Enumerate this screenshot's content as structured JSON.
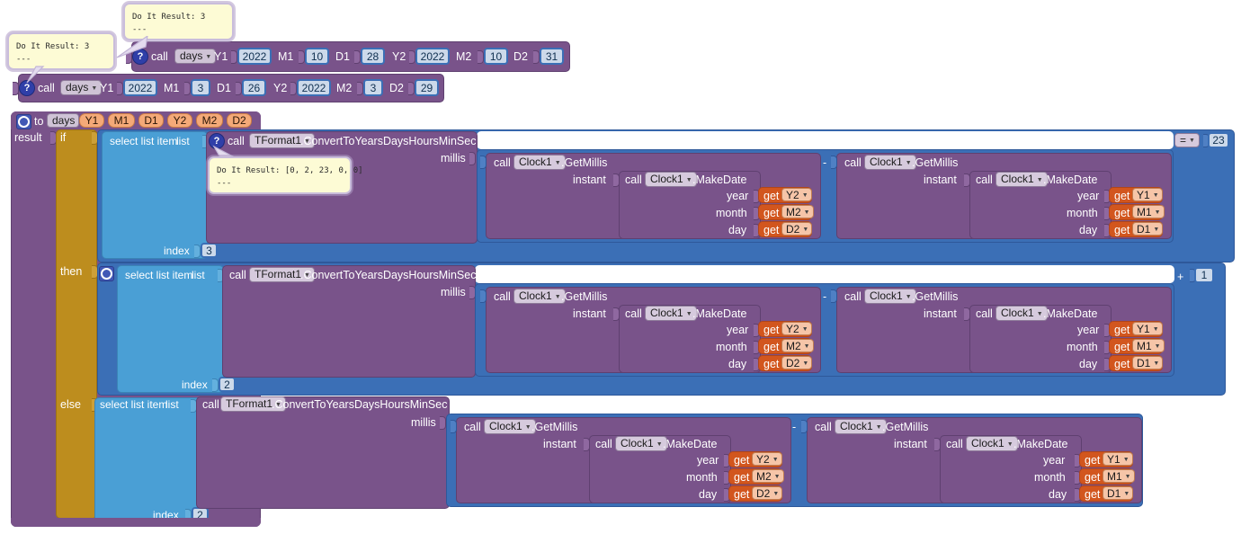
{
  "app": {
    "name": "MIT App Inventor Blocks Editor",
    "workspace_background": "#ffffff"
  },
  "colors": {
    "procedure_purple": "#79538a",
    "math_blue": "#3b6fb6",
    "list_lightblue": "#4a9fd5",
    "control_gold": "#bd8d1e",
    "variable_orange": "#d2561e",
    "number_field": "#ccd9ea",
    "comment_yellow": "#fdfbd5"
  },
  "comments": [
    {
      "id": "comment-top",
      "line1": "Do It Result: 3",
      "line2": "---"
    },
    {
      "id": "comment-left",
      "line1": "Do It Result: 3",
      "line2": "---"
    },
    {
      "id": "comment-inner",
      "line1": "Do It Result: [0, 2, 23, 0, 0]",
      "line2": "---"
    }
  ],
  "call_blocks": [
    {
      "id": "call-days-1",
      "help_glyph": "?",
      "call_label": "call",
      "procedure_name": "days",
      "params": [
        {
          "label": "Y1",
          "value": "2022"
        },
        {
          "label": "M1",
          "value": "10"
        },
        {
          "label": "D1",
          "value": "28"
        },
        {
          "label": "Y2",
          "value": "2022"
        },
        {
          "label": "M2",
          "value": "10"
        },
        {
          "label": "D2",
          "value": "31"
        }
      ]
    },
    {
      "id": "call-days-2",
      "help_glyph": "?",
      "call_label": "call",
      "procedure_name": "days",
      "params": [
        {
          "label": "Y1",
          "value": "2022"
        },
        {
          "label": "M1",
          "value": "3"
        },
        {
          "label": "D1",
          "value": "26"
        },
        {
          "label": "Y2",
          "value": "2022"
        },
        {
          "label": "M2",
          "value": "3"
        },
        {
          "label": "D2",
          "value": "29"
        }
      ]
    }
  ],
  "procedure": {
    "to_label": "to",
    "name": "days",
    "args": [
      "Y1",
      "M1",
      "D1",
      "Y2",
      "M2",
      "D2"
    ],
    "result_label": "result",
    "if_label": "if",
    "then_label": "then",
    "else_label": "else"
  },
  "rows": [
    {
      "id": "row-if",
      "select_label": "select list item",
      "list_label": "list",
      "index_label": "index",
      "index_value": "3",
      "call_label": "call",
      "component": "TFormat1",
      "method": ".ConvertToYearsDaysHoursMinSec",
      "millis_label": "millis",
      "left_call": {
        "call_label": "call",
        "component": "Clock1",
        "method": ".GetMillis",
        "instant_label": "instant",
        "inner": {
          "call_label": "call",
          "component": "Clock1",
          "method": ".MakeDate",
          "fields": [
            {
              "label": "year",
              "getter": "get",
              "variable": "Y2"
            },
            {
              "label": "month",
              "getter": "get",
              "variable": "M2"
            },
            {
              "label": "day",
              "getter": "get",
              "variable": "D2"
            }
          ]
        }
      },
      "operator": "-",
      "right_call": {
        "call_label": "call",
        "component": "Clock1",
        "method": ".GetMillis",
        "instant_label": "instant",
        "inner": {
          "call_label": "call",
          "component": "Clock1",
          "method": ".MakeDate",
          "fields": [
            {
              "label": "year",
              "getter": "get",
              "variable": "Y1"
            },
            {
              "label": "month",
              "getter": "get",
              "variable": "M1"
            },
            {
              "label": "day",
              "getter": "get",
              "variable": "D1"
            }
          ]
        }
      },
      "tail_operator": "=",
      "tail_value": "23"
    },
    {
      "id": "row-then",
      "select_label": "select list item",
      "list_label": "list",
      "index_label": "index",
      "index_value": "2",
      "call_label": "call",
      "component": "TFormat1",
      "method": ".ConvertToYearsDaysHoursMinSec",
      "millis_label": "millis",
      "left_call": {
        "call_label": "call",
        "component": "Clock1",
        "method": ".GetMillis",
        "instant_label": "instant",
        "inner": {
          "call_label": "call",
          "component": "Clock1",
          "method": ".MakeDate",
          "fields": [
            {
              "label": "year",
              "getter": "get",
              "variable": "Y2"
            },
            {
              "label": "month",
              "getter": "get",
              "variable": "M2"
            },
            {
              "label": "day",
              "getter": "get",
              "variable": "D2"
            }
          ]
        }
      },
      "operator": "-",
      "right_call": {
        "call_label": "call",
        "component": "Clock1",
        "method": ".GetMillis",
        "instant_label": "instant",
        "inner": {
          "call_label": "call",
          "component": "Clock1",
          "method": ".MakeDate",
          "fields": [
            {
              "label": "year",
              "getter": "get",
              "variable": "Y1"
            },
            {
              "label": "month",
              "getter": "get",
              "variable": "M1"
            },
            {
              "label": "day",
              "getter": "get",
              "variable": "D1"
            }
          ]
        }
      },
      "tail_operator": "+",
      "tail_value": "1"
    },
    {
      "id": "row-else",
      "select_label": "select list item",
      "list_label": "list",
      "index_label": "index",
      "index_value": "2",
      "call_label": "call",
      "component": "TFormat1",
      "method": ".ConvertToYearsDaysHoursMinSec",
      "millis_label": "millis",
      "left_call": {
        "call_label": "call",
        "component": "Clock1",
        "method": ".GetMillis",
        "instant_label": "instant",
        "inner": {
          "call_label": "call",
          "component": "Clock1",
          "method": ".MakeDate",
          "fields": [
            {
              "label": "year",
              "getter": "get",
              "variable": "Y2"
            },
            {
              "label": "month",
              "getter": "get",
              "variable": "M2"
            },
            {
              "label": "day",
              "getter": "get",
              "variable": "D2"
            }
          ]
        }
      },
      "operator": "-",
      "right_call": {
        "call_label": "call",
        "component": "Clock1",
        "method": ".GetMillis",
        "instant_label": "instant",
        "inner": {
          "call_label": "call",
          "component": "Clock1",
          "method": ".MakeDate",
          "fields": [
            {
              "label": "year",
              "getter": "get",
              "variable": "Y1"
            },
            {
              "label": "month",
              "getter": "get",
              "variable": "M1"
            },
            {
              "label": "day",
              "getter": "get",
              "variable": "D1"
            }
          ]
        }
      },
      "tail_operator": "",
      "tail_value": ""
    }
  ]
}
